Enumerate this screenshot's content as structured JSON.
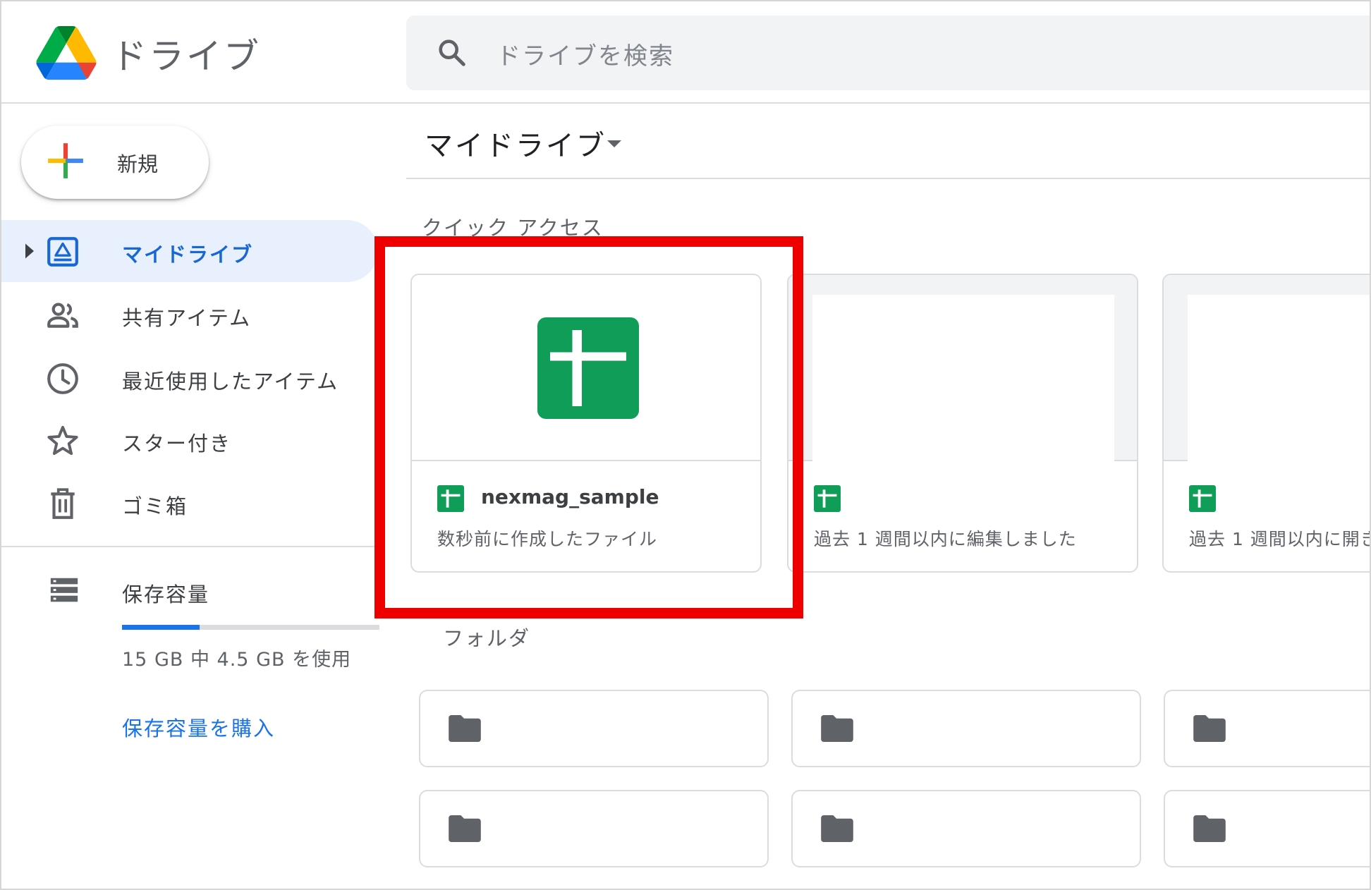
{
  "app": {
    "title": "ドライブ"
  },
  "search": {
    "placeholder": "ドライブを検索"
  },
  "sidebar": {
    "new_button": "新規",
    "items": [
      {
        "label": "マイドライブ",
        "active": true,
        "icon": "my-drive-icon"
      },
      {
        "label": "共有アイテム",
        "active": false,
        "icon": "people-icon"
      },
      {
        "label": "最近使用したアイテム",
        "active": false,
        "icon": "clock-icon"
      },
      {
        "label": "スター付き",
        "active": false,
        "icon": "star-icon"
      },
      {
        "label": "ゴミ箱",
        "active": false,
        "icon": "trash-icon"
      }
    ],
    "storage": {
      "label": "保存容量",
      "usage": "15 GB 中 4.5 GB を使用",
      "used_fraction": 0.3,
      "buy_link": "保存容量を購入"
    }
  },
  "main": {
    "title": "マイドライブ",
    "quick_access": {
      "label": "クイック アクセス",
      "cards": [
        {
          "name": "nexmag_sample",
          "subtitle": "数秒前に作成したファイル",
          "highlighted": true
        },
        {
          "name": "",
          "subtitle": "過去 1 週間以内に編集しました",
          "highlighted": false
        },
        {
          "name": "",
          "subtitle": "過去 1 週間以内に開き",
          "highlighted": false
        }
      ]
    },
    "folders": {
      "label": "フォルダ"
    }
  },
  "colors": {
    "accent": "#1a73e8",
    "active_bg": "#e8f0fe",
    "sheets_green": "#0f9d58",
    "highlight_red": "#ee0000"
  }
}
